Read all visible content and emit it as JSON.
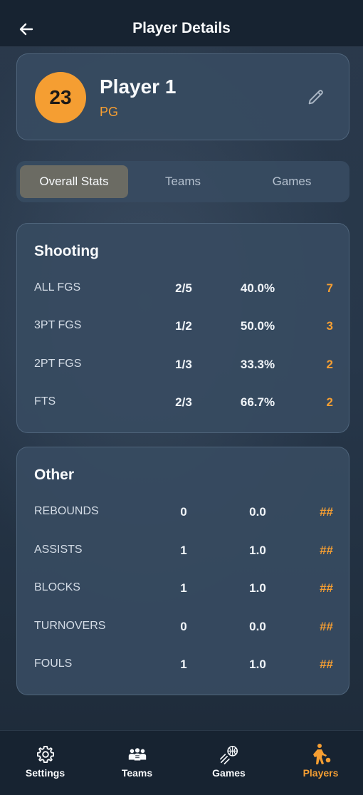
{
  "header": {
    "title": "Player Details",
    "back_icon": "arrow-left-icon"
  },
  "player": {
    "number": "23",
    "name": "Player 1",
    "position": "PG",
    "edit_icon": "pencil-icon"
  },
  "tabs": [
    {
      "label": "Overall Stats",
      "active": true
    },
    {
      "label": "Teams",
      "active": false
    },
    {
      "label": "Games",
      "active": false
    }
  ],
  "shooting": {
    "title": "Shooting",
    "rows": [
      {
        "label": "ALL FGS",
        "made": "2/5",
        "pct": "40.0%",
        "pts": "7"
      },
      {
        "label": "3PT FGS",
        "made": "1/2",
        "pct": "50.0%",
        "pts": "3"
      },
      {
        "label": "2PT FGS",
        "made": "1/3",
        "pct": "33.3%",
        "pts": "2"
      },
      {
        "label": "FTS",
        "made": "2/3",
        "pct": "66.7%",
        "pts": "2"
      }
    ]
  },
  "other": {
    "title": "Other",
    "rows": [
      {
        "label": "REBOUNDS",
        "total": "0",
        "avg": "0.0",
        "rank": "##"
      },
      {
        "label": "ASSISTS",
        "total": "1",
        "avg": "1.0",
        "rank": "##"
      },
      {
        "label": "BLOCKS",
        "total": "1",
        "avg": "1.0",
        "rank": "##"
      },
      {
        "label": "TURNOVERS",
        "total": "0",
        "avg": "0.0",
        "rank": "##"
      },
      {
        "label": "FOULS",
        "total": "1",
        "avg": "1.0",
        "rank": "##"
      }
    ]
  },
  "nav": [
    {
      "label": "Settings",
      "icon": "gear-icon",
      "active": false
    },
    {
      "label": "Teams",
      "icon": "team-icon",
      "active": false
    },
    {
      "label": "Games",
      "icon": "basketball-icon",
      "active": false
    },
    {
      "label": "Players",
      "icon": "player-dribble-icon",
      "active": true
    }
  ],
  "colors": {
    "accent": "#f59e32",
    "background": "#1f2c3b",
    "card": "#374b61",
    "bar": "#172331"
  }
}
